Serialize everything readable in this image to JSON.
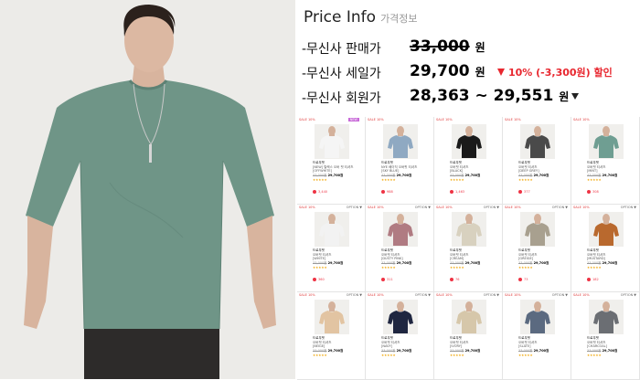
{
  "price_info": {
    "title": "Price Info",
    "subtitle": "가격정보",
    "rows": {
      "retail": {
        "label": "-무신사 판매가",
        "value": "33,000",
        "unit": "원"
      },
      "sale": {
        "label": "-무신사 세일가",
        "value": "29,700",
        "unit": "원",
        "discount": "10% (-3,300원) 할인"
      },
      "member": {
        "label": "-무신사 회원가",
        "value": "28,363 ~ 29,551",
        "unit": "원"
      }
    }
  },
  "product_grid": {
    "items": [
      {
        "sale_tag": "SALE 10%",
        "badge": "NEW",
        "option": "",
        "shirt_color": "#f5f5f5",
        "brand": "드로우핏",
        "name": "[NEW] 릴렉스 오버 핏 티셔츠",
        "color_name": "[OFFWHITE]",
        "old_price": "33,000원",
        "price": "29,700원",
        "rating": "★★★★★",
        "likes": "3,440",
        "review": ""
      },
      {
        "sale_tag": "SALE 10%",
        "badge": "",
        "option": "",
        "shirt_color": "#8fa9c2",
        "brand": "드로우핏",
        "name": "NYE 베이직 오버핏 티셔츠",
        "color_name": "[SKY BLUE]",
        "old_price": "33,000원",
        "price": "29,700원",
        "rating": "★★★★★",
        "likes": "988",
        "review": ""
      },
      {
        "sale_tag": "SALE 10%",
        "badge": "",
        "option": "",
        "shirt_color": "#1a1a1a",
        "brand": "드로우핏",
        "name": "오버핏 티셔츠",
        "color_name": "[BLACK]",
        "old_price": "33,000원",
        "price": "29,700원",
        "rating": "★★★★★",
        "likes": "1,463",
        "review": ""
      },
      {
        "sale_tag": "SALE 10%",
        "badge": "",
        "option": "",
        "shirt_color": "#4a4a4a",
        "brand": "드로우핏",
        "name": "오버핏 티셔츠",
        "color_name": "[DEEP GREY]",
        "old_price": "33,000원",
        "price": "29,700원",
        "rating": "★★★★★",
        "likes": "377",
        "review": ""
      },
      {
        "sale_tag": "SALE 10%",
        "badge": "",
        "option": "",
        "shirt_color": "#6f9e92",
        "brand": "드로우핏",
        "name": "오버핏 티셔츠",
        "color_name": "[MINT]",
        "old_price": "33,000원",
        "price": "29,700원",
        "rating": "★★★★★",
        "likes": "308",
        "review": ""
      },
      {
        "sale_tag": "SALE 10%",
        "badge": "",
        "option": "OPTION ▼",
        "shirt_color": "#f2f2f2",
        "brand": "드로우핏",
        "name": "오버핏 티셔츠",
        "color_name": "[WHITE]",
        "old_price": "33,000원",
        "price": "29,700원",
        "rating": "★★★★★",
        "likes": "360",
        "review": ""
      },
      {
        "sale_tag": "SALE 10%",
        "badge": "",
        "option": "OPTION ▼",
        "shirt_color": "#b07b82",
        "brand": "드로우핏",
        "name": "오버핏 티셔츠",
        "color_name": "[DUSTY PINK]",
        "old_price": "33,000원",
        "price": "29,700원",
        "rating": "★★★★★",
        "likes": "311",
        "review": ""
      },
      {
        "sale_tag": "SALE 10%",
        "badge": "",
        "option": "OPTION ▼",
        "shirt_color": "#d8d1bf",
        "brand": "드로우핏",
        "name": "오버핏 티셔츠",
        "color_name": "[CREAM]",
        "old_price": "33,000원",
        "price": "29,700원",
        "rating": "★★★★★",
        "likes": "76",
        "review": ""
      },
      {
        "sale_tag": "SALE 10%",
        "badge": "",
        "option": "OPTION ▼",
        "shirt_color": "#a8a08f",
        "brand": "드로우핏",
        "name": "오버핏 티셔츠",
        "color_name": "[GREIGE]",
        "old_price": "33,000원",
        "price": "29,700원",
        "rating": "★★★★★",
        "likes": "73",
        "review": ""
      },
      {
        "sale_tag": "SALE 10%",
        "badge": "",
        "option": "OPTION ▼",
        "shirt_color": "#b9692e",
        "brand": "드로우핏",
        "name": "오버핏 티셔츠",
        "color_name": "[MUSTARD]",
        "old_price": "33,000원",
        "price": "29,700원",
        "rating": "★★★★★",
        "likes": "182",
        "review": ""
      },
      {
        "sale_tag": "SALE 10%",
        "badge": "",
        "option": "OPTION ▼",
        "shirt_color": "#e2c4a2",
        "brand": "드로우핏",
        "name": "오버핏 티셔츠",
        "color_name": "[BEIGE]",
        "old_price": "33,000원",
        "price": "29,700원",
        "rating": "★★★★★",
        "likes": "",
        "review": ""
      },
      {
        "sale_tag": "SALE 10%",
        "badge": "",
        "option": "OPTION ▼",
        "shirt_color": "#1f2640",
        "brand": "드로우핏",
        "name": "오버핏 티셔츠",
        "color_name": "[NAVY]",
        "old_price": "33,000원",
        "price": "29,700원",
        "rating": "★★★★★",
        "likes": "",
        "review": ""
      },
      {
        "sale_tag": "SALE 10%",
        "badge": "",
        "option": "OPTION ▼",
        "shirt_color": "#d6c7aa",
        "brand": "드로우핏",
        "name": "오버핏 티셔츠",
        "color_name": "[IVORY]",
        "old_price": "33,000원",
        "price": "29,700원",
        "rating": "★★★★★",
        "likes": "",
        "review": ""
      },
      {
        "sale_tag": "SALE 10%",
        "badge": "",
        "option": "OPTION ▼",
        "shirt_color": "#5b6a80",
        "brand": "드로우핏",
        "name": "오버핏 티셔츠",
        "color_name": "[SLATE]",
        "old_price": "33,000원",
        "price": "29,700원",
        "rating": "★★★★★",
        "likes": "",
        "review": ""
      },
      {
        "sale_tag": "SALE 10%",
        "badge": "",
        "option": "OPTION ▼",
        "shirt_color": "#6b6e73",
        "brand": "드로우핏",
        "name": "오버핏 티셔츠",
        "color_name": "[CHARCOAL]",
        "old_price": "33,000원",
        "price": "29,700원",
        "rating": "★★★★★",
        "likes": "",
        "review": ""
      }
    ]
  },
  "colors": {
    "discount_red": "#e8272f",
    "hero_shirt": "#6f9587",
    "hero_bg": "#ececea"
  }
}
